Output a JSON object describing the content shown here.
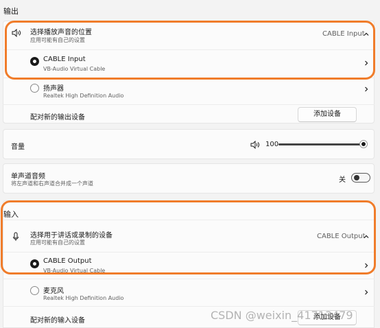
{
  "output": {
    "section_title": "输出",
    "choose_row": {
      "title": "选择播放声音的位置",
      "subtitle": "应用可能有自己的设置",
      "value": "CABLE Input"
    },
    "devices": [
      {
        "name": "CABLE Input",
        "desc": "VB-Audio Virtual Cable",
        "selected": true
      },
      {
        "name": "扬声器",
        "desc": "Realtek High Definition Audio",
        "selected": false
      }
    ],
    "pair_row": {
      "label": "配对新的输出设备",
      "button": "添加设备"
    }
  },
  "volume": {
    "label": "音量",
    "value": "100",
    "level_fraction": 1.0
  },
  "mono": {
    "title": "单声道音频",
    "subtitle": "将左声道和右声道合并成一个声道",
    "state_label": "关"
  },
  "input": {
    "section_title": "输入",
    "choose_row": {
      "title": "选择用于讲话或录制的设备",
      "subtitle": "应用可能有自己的设置",
      "value": "CABLE Output"
    },
    "devices": [
      {
        "name": "CABLE Output",
        "desc": "VB-Audio Virtual Cable",
        "selected": true
      },
      {
        "name": "麦克风",
        "desc": "Realtek High Definition Audio",
        "selected": false
      }
    ],
    "pair_row": {
      "label": "配对新的输入设备",
      "button": "添加设备"
    }
  },
  "watermark": "CSDN @weixin_41713479",
  "colors": {
    "highlight": "#f07c2a",
    "background": "#f3f3f3",
    "card": "#fbfbfb"
  }
}
